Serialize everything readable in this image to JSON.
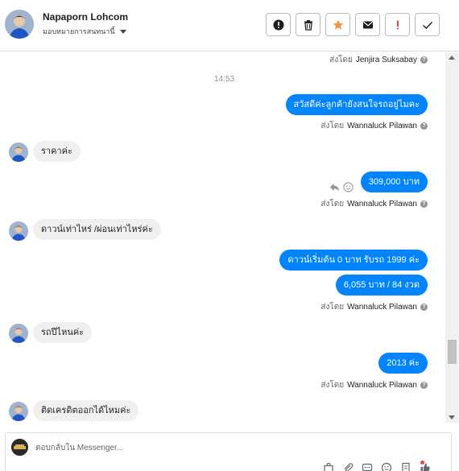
{
  "header": {
    "name": "Napaporn Lohcom",
    "assign_label": "มอบหมายการสนทนานี้",
    "actions": [
      "flag-icon",
      "trash-icon",
      "star-icon",
      "mail-icon",
      "important-icon",
      "check-icon"
    ],
    "colors": {
      "star": "#f7923b",
      "important": "#fa3e3e"
    }
  },
  "conversation": {
    "sent_by_prefix": "ส่งโดย",
    "items": [
      {
        "type": "sent_by",
        "agent": "Jenjira Suksabay"
      },
      {
        "type": "time",
        "text": "14:53"
      },
      {
        "type": "out",
        "text": "สวัสดีค่ะลูกค้ายังสนใจรถอยู่ไมคะ"
      },
      {
        "type": "sent_by",
        "agent": "Wannaluck Pilawan"
      },
      {
        "type": "in",
        "text": "ราคาค่ะ"
      },
      {
        "type": "out",
        "text": "309,000 บาท"
      },
      {
        "type": "sent_by",
        "agent": "Wannaluck Pilawan"
      },
      {
        "type": "in",
        "text": "ดาวน์เท่าไหร่ /ผ่อนเท่าไหร่ค่ะ"
      },
      {
        "type": "out",
        "text": "ดาวน์เริ่มต้น 0 บาท รับรถ 1999 ค่ะ"
      },
      {
        "type": "out",
        "text": "6,055 บาท   / 84 งวด"
      },
      {
        "type": "sent_by",
        "agent": "Wannaluck Pilawan"
      },
      {
        "type": "in",
        "text": "รถปีไหนค่ะ"
      },
      {
        "type": "out",
        "text": "2013  ค่ะ"
      },
      {
        "type": "sent_by",
        "agent": "Wannaluck Pilawan"
      },
      {
        "type": "in",
        "text": "ติดเครดิตออกได้ไหมค่ะ"
      }
    ],
    "colors": {
      "outgoing": "#0084ff",
      "incoming": "#f1f0f0"
    }
  },
  "composer": {
    "placeholder": "ตอบกลับใน Messenger..."
  }
}
